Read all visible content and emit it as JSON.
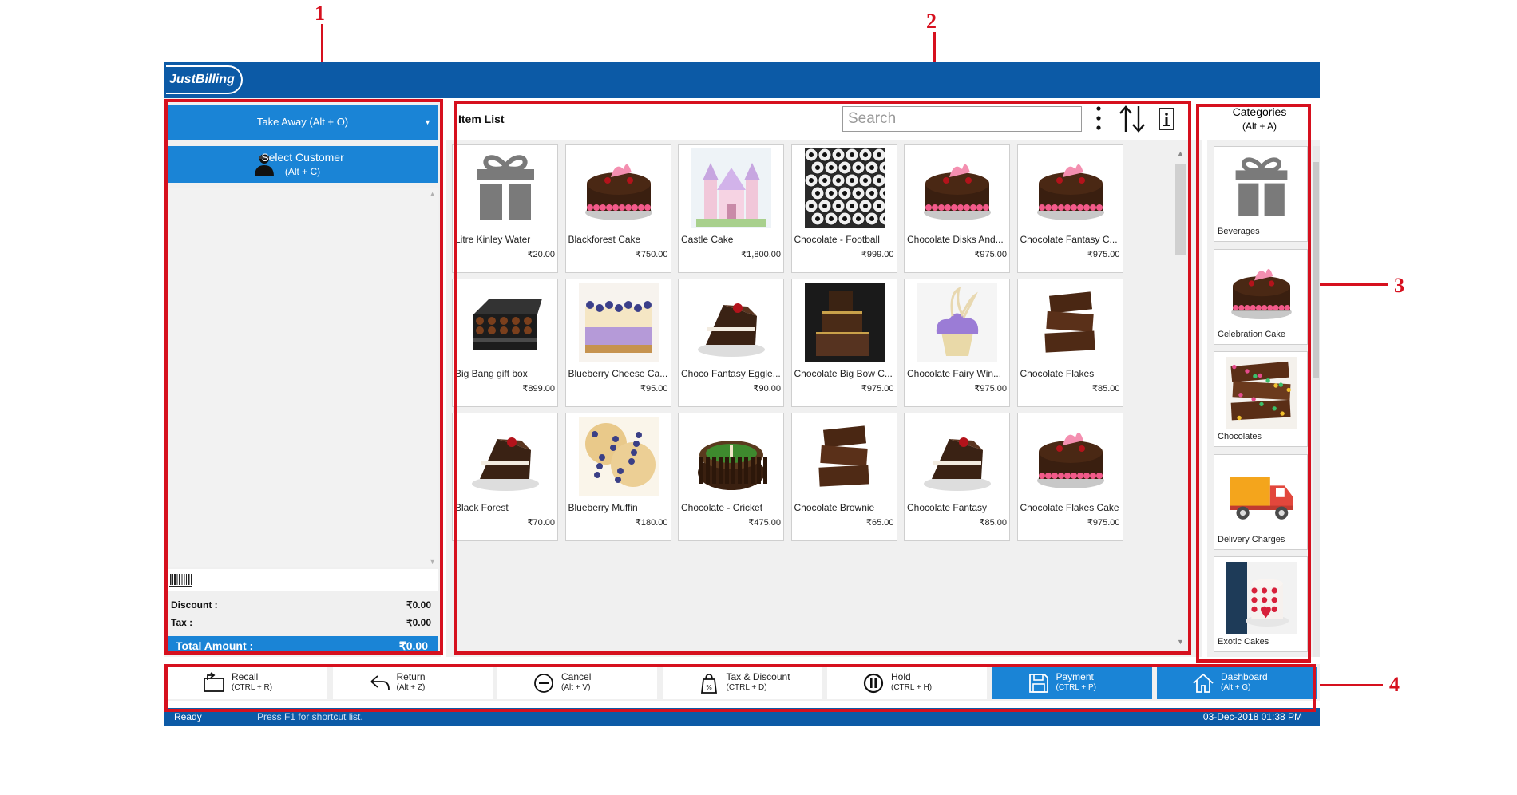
{
  "app": {
    "logo_text": "JustBilling"
  },
  "annotations": [
    "1",
    "2",
    "3",
    "4"
  ],
  "left_panel": {
    "order_type": "Take Away (Alt + O)",
    "customer_label": "Select Customer",
    "customer_shortcut": "(Alt + C)",
    "discount_label": "Discount :",
    "discount_value": "₹0.00",
    "tax_label": "Tax :",
    "tax_value": "₹0.00",
    "total_label": "Total Amount :",
    "total_value": "₹0.00"
  },
  "item_list": {
    "title": "Item List",
    "search_placeholder": "Search",
    "items": [
      {
        "name": "Litre Kinley Water",
        "price": "₹20.00",
        "icon": "gift-icon"
      },
      {
        "name": "Blackforest Cake",
        "price": "₹750.00",
        "icon": "cake-photo"
      },
      {
        "name": "Castle Cake",
        "price": "₹1,800.00",
        "icon": "castle-cake-photo"
      },
      {
        "name": "Chocolate - Football",
        "price": "₹999.00",
        "icon": "football-photo"
      },
      {
        "name": "Chocolate Disks And...",
        "price": "₹975.00",
        "icon": "cake-photo"
      },
      {
        "name": "Chocolate Fantasy C...",
        "price": "₹975.00",
        "icon": "cake-photo"
      },
      {
        "name": "Big Bang gift box",
        "price": "₹899.00",
        "icon": "gift-box-photo"
      },
      {
        "name": "Blueberry Cheese Ca...",
        "price": "₹95.00",
        "icon": "cheesecake-photo"
      },
      {
        "name": "Choco Fantasy Eggle...",
        "price": "₹90.00",
        "icon": "pastry-photo"
      },
      {
        "name": "Chocolate Big Bow C...",
        "price": "₹975.00",
        "icon": "tower-cake-photo"
      },
      {
        "name": "Chocolate Fairy Win...",
        "price": "₹975.00",
        "icon": "cupcake-photo"
      },
      {
        "name": "Chocolate Flakes",
        "price": "₹85.00",
        "icon": "brownie-photo"
      },
      {
        "name": "Black Forest",
        "price": "₹70.00",
        "icon": "pastry-photo"
      },
      {
        "name": "Blueberry Muffin",
        "price": "₹180.00",
        "icon": "muffin-photo"
      },
      {
        "name": "Chocolate - Cricket",
        "price": "₹475.00",
        "icon": "cricket-cake-photo"
      },
      {
        "name": "Chocolate Brownie",
        "price": "₹65.00",
        "icon": "brownie-photo"
      },
      {
        "name": "Chocolate Fantasy",
        "price": "₹85.00",
        "icon": "pastry-photo"
      },
      {
        "name": "Chocolate Flakes Cake",
        "price": "₹975.00",
        "icon": "cake-photo"
      }
    ]
  },
  "categories": {
    "title": "Categories",
    "shortcut": "(Alt + A)",
    "items": [
      {
        "name": "Beverages",
        "icon": "gift-icon"
      },
      {
        "name": "Celebration Cake",
        "icon": "cake-photo"
      },
      {
        "name": "Chocolates",
        "icon": "chocolate-photo"
      },
      {
        "name": "Delivery Charges",
        "icon": "truck-icon"
      },
      {
        "name": "Exotic Cakes",
        "icon": "exotic-cake-photo"
      }
    ]
  },
  "toolbar": [
    {
      "label": "Recall",
      "shortcut": "(CTRL + R)",
      "icon": "recall-icon",
      "primary": false
    },
    {
      "label": "Return",
      "shortcut": "(Alt + Z)",
      "icon": "return-icon",
      "primary": false
    },
    {
      "label": "Cancel",
      "shortcut": "(Alt + V)",
      "icon": "cancel-icon",
      "primary": false
    },
    {
      "label": "Tax & Discount",
      "shortcut": "(CTRL + D)",
      "icon": "tax-icon",
      "primary": false
    },
    {
      "label": "Hold",
      "shortcut": "(CTRL + H)",
      "icon": "pause-icon",
      "primary": false
    },
    {
      "label": "Payment",
      "shortcut": "(CTRL + P)",
      "icon": "save-icon",
      "primary": true
    },
    {
      "label": "Dashboard",
      "shortcut": "(Alt + G)",
      "icon": "home-icon",
      "primary": true
    }
  ],
  "status": {
    "state": "Ready",
    "hint": "Press F1 for shortcut list.",
    "datetime": "03-Dec-2018 01:38 PM"
  },
  "colors": {
    "titlebar": "#0c5aa6",
    "accent": "#1a84d6",
    "annotation": "#d6101e"
  }
}
